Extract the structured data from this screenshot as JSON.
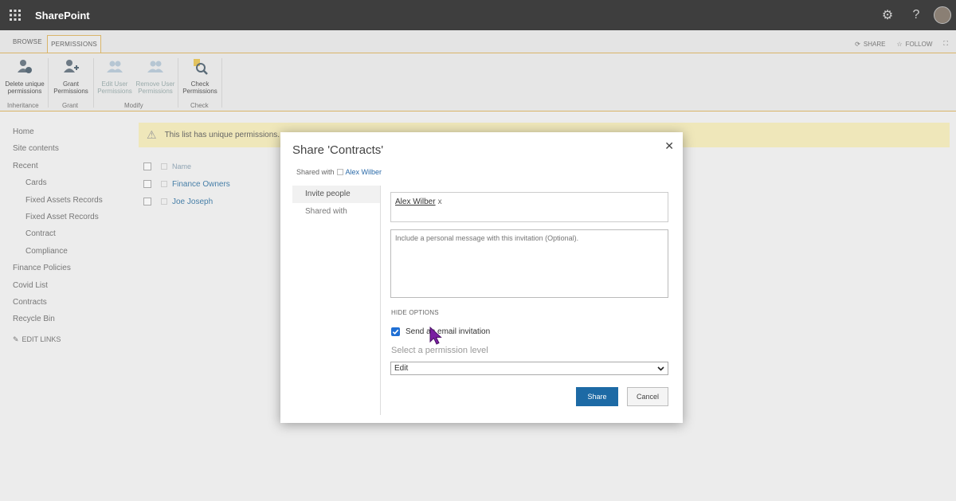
{
  "suite": {
    "app_title": "SharePoint"
  },
  "ribbon": {
    "tabs": [
      "BROWSE",
      "PERMISSIONS"
    ],
    "right": {
      "share": "SHARE",
      "follow": "FOLLOW"
    },
    "buttons": [
      {
        "line1": "Delete unique",
        "line2": "permissions"
      },
      {
        "line1": "Grant",
        "line2": "Permissions"
      },
      {
        "line1": "Edit User",
        "line2": "Permissions"
      },
      {
        "line1": "Remove User",
        "line2": "Permissions"
      },
      {
        "line1": "Check",
        "line2": "Permissions"
      }
    ],
    "groups": [
      "Inheritance",
      "Grant",
      "Modify",
      "Check"
    ]
  },
  "leftnav": {
    "items": [
      "Home",
      "Site contents",
      "Recent",
      "Cards",
      "Fixed Assets Records",
      "Fixed Asset Records",
      "Contract",
      "Compliance",
      "Finance Policies",
      "Covid List",
      "Contracts",
      "Recycle Bin"
    ],
    "edit_links": "EDIT LINKS"
  },
  "warning": {
    "text": "This list has unique permissions."
  },
  "list": {
    "header": "Name",
    "rows": [
      "Finance Owners",
      "Joe Joseph"
    ]
  },
  "dialog": {
    "title": "Share 'Contracts'",
    "close": "✕",
    "shared_with_label": "Shared with",
    "shared_with_user": "Alex Wilber",
    "tabs": [
      "Invite people",
      "Shared with"
    ],
    "recipient": "Alex Wilber",
    "recipient_remove": "x",
    "message_placeholder": "Include a personal message with this invitation (Optional).",
    "hide_options": "HIDE OPTIONS",
    "email_invitation": "Send an email invitation",
    "email_checked": true,
    "permission_label": "Select a permission level",
    "permission_value": "Edit",
    "share_button": "Share",
    "cancel_button": "Cancel"
  },
  "colors": {
    "suitebar": "#3e3e3e",
    "primary": "#1d6aa5",
    "warning_bg": "#efe7ba",
    "accent_border": "#d9b56a"
  }
}
